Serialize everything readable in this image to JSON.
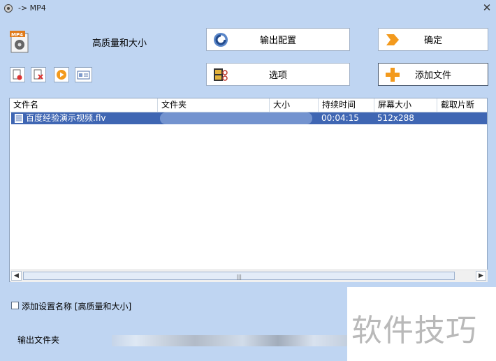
{
  "window": {
    "title": "-> MP4"
  },
  "preset": {
    "name": "高质量和大小",
    "format_badge": "MP4"
  },
  "buttons": {
    "output_config": "输出配置",
    "confirm": "确定",
    "options": "选项",
    "add_file": "添加文件"
  },
  "columns": [
    "文件名",
    "文件夹",
    "大小",
    "持续时间",
    "屏幕大小",
    "截取片断"
  ],
  "files": [
    {
      "name": "百度经验演示视频.flv",
      "folder": "",
      "size": "",
      "duration": "00:04:15",
      "screen_size": "512x288",
      "clip": ""
    }
  ],
  "options": {
    "add_preset_name_label": "添加设置名称 [高质量和大小]"
  },
  "output": {
    "folder_label": "输出文件夹"
  },
  "watermark": "软件技巧",
  "colors": {
    "background": "#bfd5f2",
    "selection": "#3f66b3",
    "accent_orange": "#f39a1d"
  }
}
